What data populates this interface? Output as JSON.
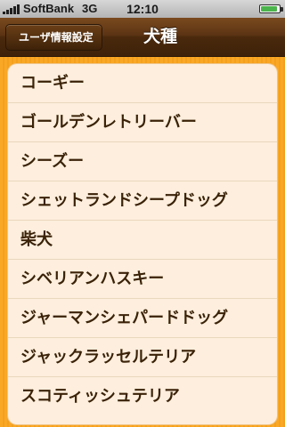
{
  "status_bar": {
    "carrier": "SoftBank",
    "network": "3G",
    "time": "12:10",
    "battery_level": 0.9
  },
  "nav": {
    "back_label": "ユーザ情報設定",
    "title": "犬種"
  },
  "breeds": [
    "コーギー",
    "ゴールデンレトリーバー",
    "シーズー",
    "シェットランドシープドッグ",
    "柴犬",
    "シベリアンハスキー",
    "ジャーマンシェパードドッグ",
    "ジャックラッセルテリア",
    "スコティッシュテリア"
  ],
  "colors": {
    "background": "#f9a826",
    "nav": "#4a290d",
    "card": "#fdeedd",
    "text": "#3a2208"
  }
}
